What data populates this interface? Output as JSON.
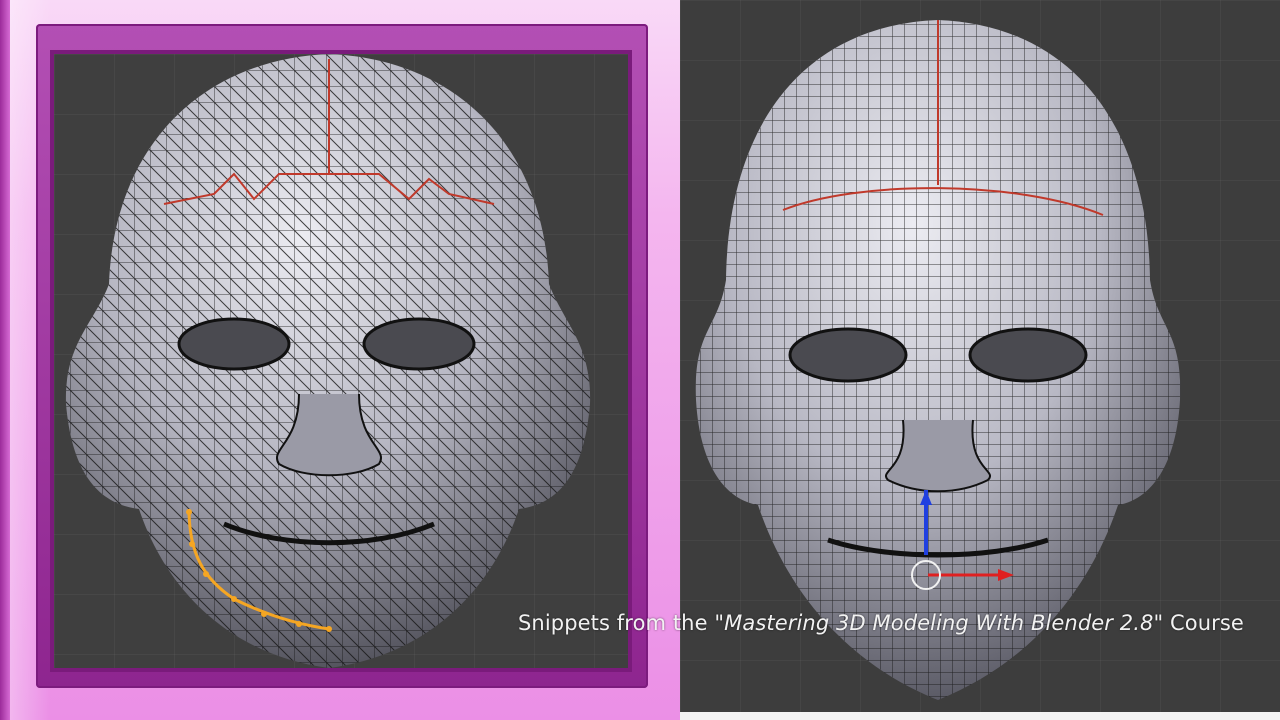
{
  "caption": {
    "prefix": "Snippets from the \"",
    "course_title": "Mastering 3D Modeling With Blender 2.8",
    "suffix": "\" Course"
  },
  "left_viewport": {
    "content": "head-mesh-wireframe-before",
    "highlight_color": "#f5a623",
    "seam_color": "#c0392b"
  },
  "right_viewport": {
    "content": "head-mesh-wireframe-after",
    "gizmo_colors": {
      "x_axis": "#e02020",
      "z_axis": "#2040e0"
    }
  },
  "colors": {
    "viewport_bg": "#3d3d3d",
    "frame_accent": "#b34fb4",
    "mesh_fill": "#c9c9d2",
    "wire": "#111111"
  }
}
